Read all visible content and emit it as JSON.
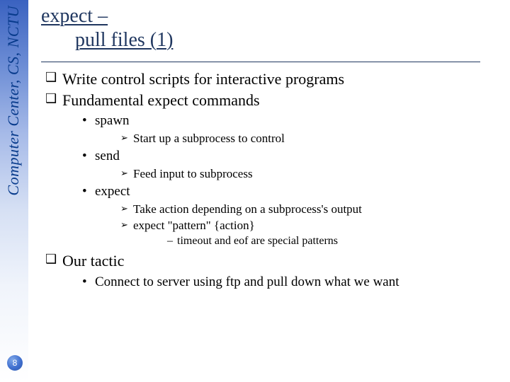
{
  "sidebar": {
    "org_text": "Computer Center, CS, NCTU"
  },
  "page_number": "8",
  "title": {
    "line1": "expect –",
    "line2": "pull files (1)"
  },
  "bullets": {
    "b1": "Write control scripts for interactive programs",
    "b2": "Fundamental expect commands",
    "b2_items": {
      "i1": "spawn",
      "i1_sub1": "Start up a subprocess to control",
      "i2": "send",
      "i2_sub1": "Feed input to subprocess",
      "i3": "expect",
      "i3_sub1": "Take action depending on a subprocess's output",
      "i3_sub2": "expect \"pattern\" {action}",
      "i3_sub2_dash1": "timeout and eof are special patterns"
    },
    "b3": "Our tactic",
    "b3_items": {
      "i1": "Connect to server using ftp and pull down what we want"
    }
  }
}
